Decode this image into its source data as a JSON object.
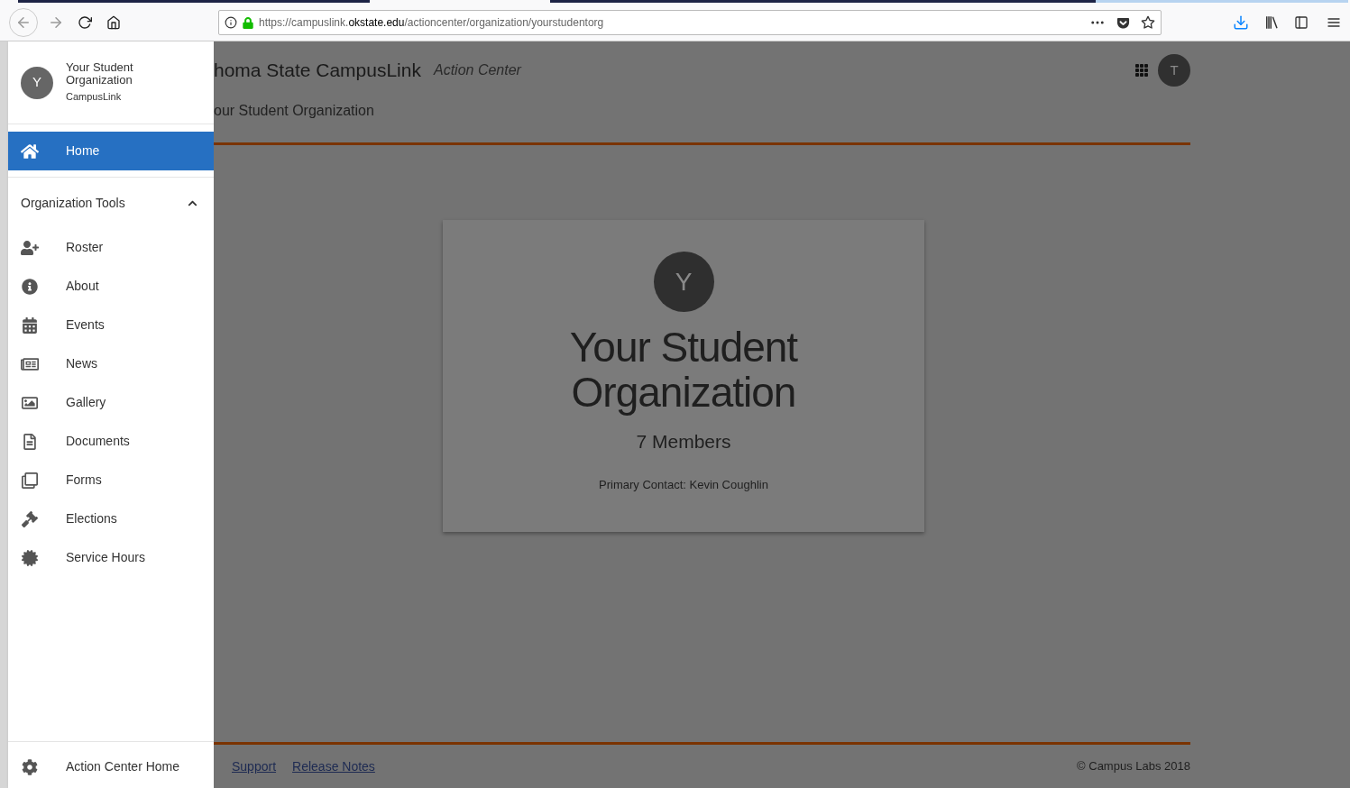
{
  "browser": {
    "url": "https://campuslink.**okstate.edu**/actioncenter/organization/yourstudentorg"
  },
  "drawer": {
    "org": {
      "avatar": "Y",
      "name": "Your Student Organization",
      "subtitle": "CampusLink"
    },
    "home": {
      "label": "Home",
      "selected": true
    },
    "section": {
      "title": "Organization Tools",
      "expanded": true
    },
    "items": [
      {
        "label": "Roster",
        "selected": false
      },
      {
        "label": "About",
        "selected": false
      },
      {
        "label": "Events",
        "selected": false
      },
      {
        "label": "News",
        "selected": false
      },
      {
        "label": "Gallery",
        "selected": false
      },
      {
        "label": "Documents",
        "selected": false
      },
      {
        "label": "Forms",
        "selected": false
      },
      {
        "label": "Elections",
        "selected": false
      },
      {
        "label": "Service Hours",
        "selected": false
      }
    ],
    "footer_item": {
      "label": "Action Center Home",
      "selected": false
    }
  },
  "header": {
    "title": "homa State CampusLink",
    "subtitle": "Action Center",
    "avatar": "T",
    "breadcrumb": "our Student Organization"
  },
  "card": {
    "avatar": "Y",
    "name": "Your Student Organization",
    "members": "7 Members",
    "contact": "Primary Contact: Kevin Coughlin"
  },
  "footer": {
    "links": [
      "Support",
      "Release Notes"
    ],
    "copyright": "© Campus Labs 2018"
  }
}
